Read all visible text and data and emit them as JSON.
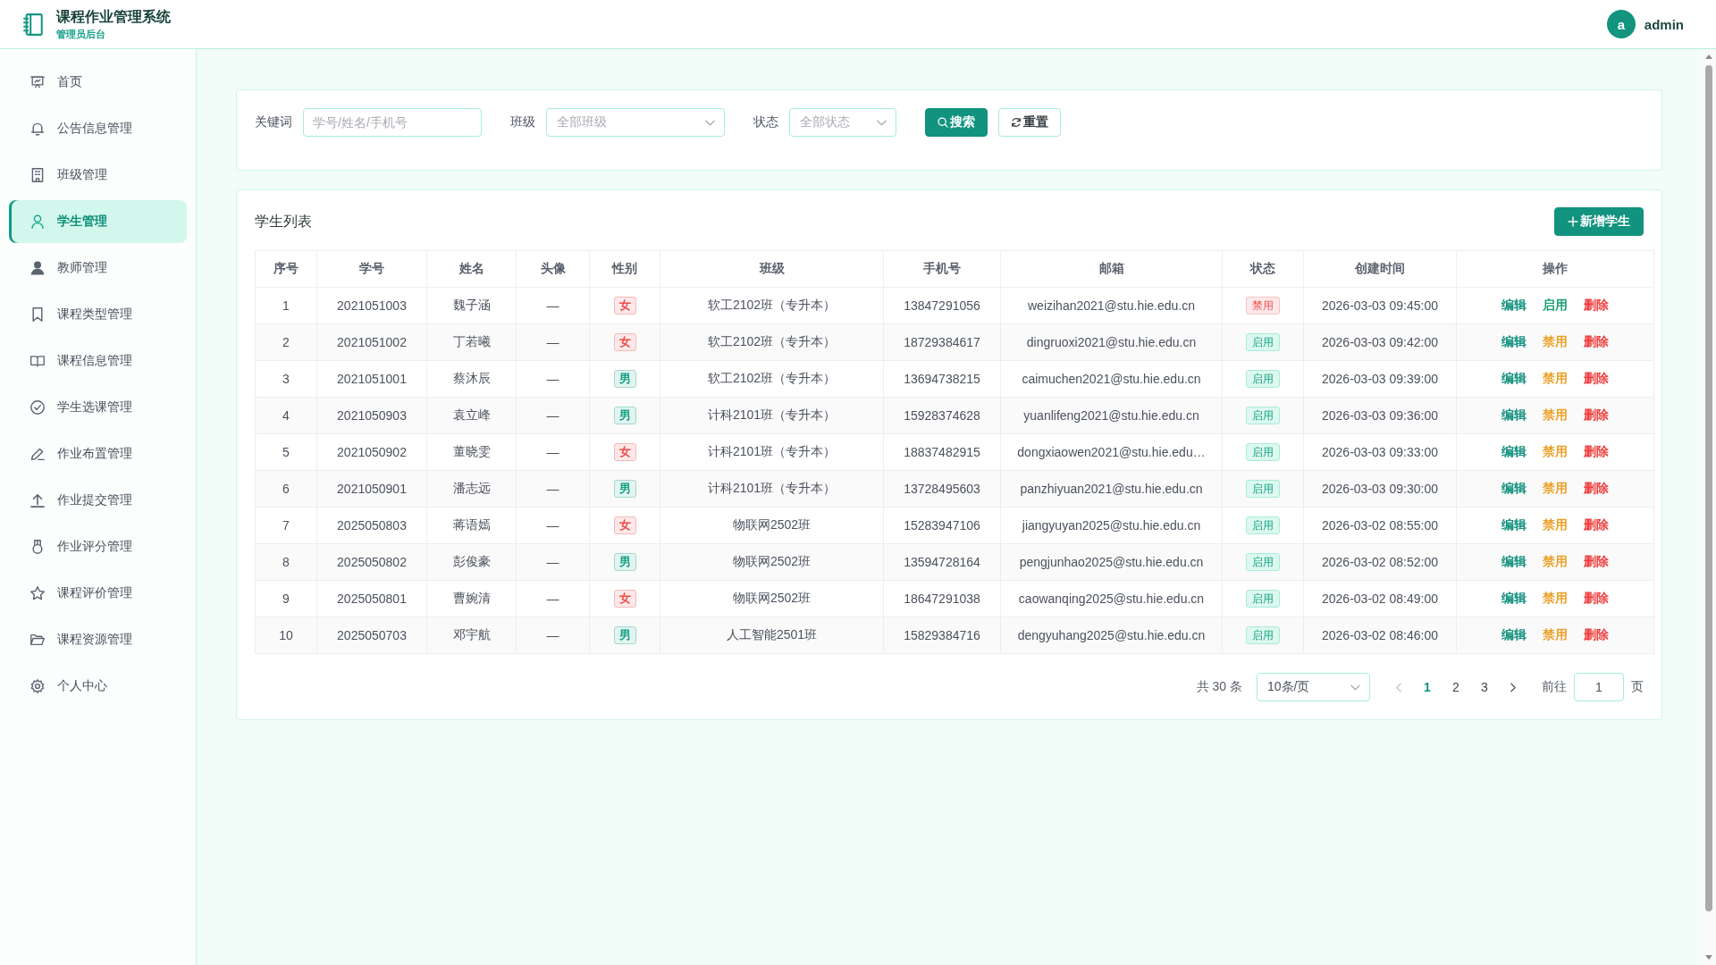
{
  "header": {
    "title": "课程作业管理系统",
    "subtitle": "管理员后台",
    "user": {
      "initial": "a",
      "name": "admin"
    }
  },
  "sidebar": {
    "items": [
      {
        "label": "首页",
        "selected": false
      },
      {
        "label": "公告信息管理",
        "selected": false
      },
      {
        "label": "班级管理",
        "selected": false
      },
      {
        "label": "学生管理",
        "selected": true
      },
      {
        "label": "教师管理",
        "selected": false
      },
      {
        "label": "课程类型管理",
        "selected": false
      },
      {
        "label": "课程信息管理",
        "selected": false
      },
      {
        "label": "学生选课管理",
        "selected": false
      },
      {
        "label": "作业布置管理",
        "selected": false
      },
      {
        "label": "作业提交管理",
        "selected": false
      },
      {
        "label": "作业评分管理",
        "selected": false
      },
      {
        "label": "课程评价管理",
        "selected": false
      },
      {
        "label": "课程资源管理",
        "selected": false
      },
      {
        "label": "个人中心",
        "selected": false
      }
    ]
  },
  "filters": {
    "fields": [
      {
        "label": "关键词",
        "kind": "input",
        "placeholder": "学号/姓名/手机号"
      },
      {
        "label": "班级",
        "kind": "select",
        "placeholder": "全部班级"
      },
      {
        "label": "状态",
        "kind": "select",
        "placeholder": "全部状态"
      }
    ],
    "buttons": [
      {
        "label": "搜索",
        "kind": "search"
      },
      {
        "label": "重置",
        "kind": "reset"
      }
    ]
  },
  "student_list": {
    "title": "学生列表",
    "add_button": "新增学生",
    "columns": [
      "序号",
      "学号",
      "姓名",
      "头像",
      "性别",
      "班级",
      "手机号",
      "邮箱",
      "状态",
      "创建时间",
      "操作"
    ],
    "rows": [
      {
        "index": "1",
        "student_id": "2021051003",
        "name": "魏子涵",
        "avatar": "—",
        "gender": {
          "label": "女",
          "color": "#f04b4b"
        },
        "class": "软工2102班（专升本）",
        "phone": "13847291056",
        "email": "weizihan2021@stu.hie.edu.cn",
        "status": {
          "label": "禁用",
          "enabled": false
        },
        "created_at": "2026-03-03 09:45:00",
        "actions": [
          {
            "label": "编辑",
            "kind": "edit"
          },
          {
            "label": "启用",
            "kind": "enable"
          },
          {
            "label": "删除",
            "kind": "delete"
          }
        ]
      },
      {
        "index": "2",
        "student_id": "2021051002",
        "name": "丁若曦",
        "avatar": "—",
        "gender": {
          "label": "女",
          "color": "#f04b4b"
        },
        "class": "软工2102班（专升本）",
        "phone": "18729384617",
        "email": "dingruoxi2021@stu.hie.edu.cn",
        "status": {
          "label": "启用",
          "enabled": true
        },
        "created_at": "2026-03-03 09:42:00",
        "actions": [
          {
            "label": "编辑",
            "kind": "edit"
          },
          {
            "label": "禁用",
            "kind": "disable"
          },
          {
            "label": "删除",
            "kind": "delete"
          }
        ]
      },
      {
        "index": "3",
        "student_id": "2021051001",
        "name": "蔡沐辰",
        "avatar": "—",
        "gender": {
          "label": "男",
          "color": "#13a084"
        },
        "class": "软工2102班（专升本）",
        "phone": "13694738215",
        "email": "caimuchen2021@stu.hie.edu.cn",
        "status": {
          "label": "启用",
          "enabled": true
        },
        "created_at": "2026-03-03 09:39:00",
        "actions": [
          {
            "label": "编辑",
            "kind": "edit"
          },
          {
            "label": "禁用",
            "kind": "disable"
          },
          {
            "label": "删除",
            "kind": "delete"
          }
        ]
      },
      {
        "index": "4",
        "student_id": "2021050903",
        "name": "袁立峰",
        "avatar": "—",
        "gender": {
          "label": "男",
          "color": "#13a084"
        },
        "class": "计科2101班（专升本）",
        "phone": "15928374628",
        "email": "yuanlifeng2021@stu.hie.edu.cn",
        "status": {
          "label": "启用",
          "enabled": true
        },
        "created_at": "2026-03-03 09:36:00",
        "actions": [
          {
            "label": "编辑",
            "kind": "edit"
          },
          {
            "label": "禁用",
            "kind": "disable"
          },
          {
            "label": "删除",
            "kind": "delete"
          }
        ]
      },
      {
        "index": "5",
        "student_id": "2021050902",
        "name": "董晓雯",
        "avatar": "—",
        "gender": {
          "label": "女",
          "color": "#f04b4b"
        },
        "class": "计科2101班（专升本）",
        "phone": "18837482915",
        "email": "dongxiaowen2021@stu.hie.edu…",
        "status": {
          "label": "启用",
          "enabled": true
        },
        "created_at": "2026-03-03 09:33:00",
        "actions": [
          {
            "label": "编辑",
            "kind": "edit"
          },
          {
            "label": "禁用",
            "kind": "disable"
          },
          {
            "label": "删除",
            "kind": "delete"
          }
        ]
      },
      {
        "index": "6",
        "student_id": "2021050901",
        "name": "潘志远",
        "avatar": "—",
        "gender": {
          "label": "男",
          "color": "#13a084"
        },
        "class": "计科2101班（专升本）",
        "phone": "13728495603",
        "email": "panzhiyuan2021@stu.hie.edu.cn",
        "status": {
          "label": "启用",
          "enabled": true
        },
        "created_at": "2026-03-03 09:30:00",
        "actions": [
          {
            "label": "编辑",
            "kind": "edit"
          },
          {
            "label": "禁用",
            "kind": "disable"
          },
          {
            "label": "删除",
            "kind": "delete"
          }
        ]
      },
      {
        "index": "7",
        "student_id": "2025050803",
        "name": "蒋语嫣",
        "avatar": "—",
        "gender": {
          "label": "女",
          "color": "#f04b4b"
        },
        "class": "物联网2502班",
        "phone": "15283947106",
        "email": "jiangyuyan2025@stu.hie.edu.cn",
        "status": {
          "label": "启用",
          "enabled": true
        },
        "created_at": "2026-03-02 08:55:00",
        "actions": [
          {
            "label": "编辑",
            "kind": "edit"
          },
          {
            "label": "禁用",
            "kind": "disable"
          },
          {
            "label": "删除",
            "kind": "delete"
          }
        ]
      },
      {
        "index": "8",
        "student_id": "2025050802",
        "name": "彭俊豪",
        "avatar": "—",
        "gender": {
          "label": "男",
          "color": "#13a084"
        },
        "class": "物联网2502班",
        "phone": "13594728164",
        "email": "pengjunhao2025@stu.hie.edu.cn",
        "status": {
          "label": "启用",
          "enabled": true
        },
        "created_at": "2026-03-02 08:52:00",
        "actions": [
          {
            "label": "编辑",
            "kind": "edit"
          },
          {
            "label": "禁用",
            "kind": "disable"
          },
          {
            "label": "删除",
            "kind": "delete"
          }
        ]
      },
      {
        "index": "9",
        "student_id": "2025050801",
        "name": "曹婉清",
        "avatar": "—",
        "gender": {
          "label": "女",
          "color": "#f04b4b"
        },
        "class": "物联网2502班",
        "phone": "18647291038",
        "email": "caowanqing2025@stu.hie.edu.cn",
        "status": {
          "label": "启用",
          "enabled": true
        },
        "created_at": "2026-03-02 08:49:00",
        "actions": [
          {
            "label": "编辑",
            "kind": "edit"
          },
          {
            "label": "禁用",
            "kind": "disable"
          },
          {
            "label": "删除",
            "kind": "delete"
          }
        ]
      },
      {
        "index": "10",
        "student_id": "2025050703",
        "name": "邓宇航",
        "avatar": "—",
        "gender": {
          "label": "男",
          "color": "#13a084"
        },
        "class": "人工智能2501班",
        "phone": "15829384716",
        "email": "dengyuhang2025@stu.hie.edu.cn",
        "status": {
          "label": "启用",
          "enabled": true
        },
        "created_at": "2026-03-02 08:46:00",
        "actions": [
          {
            "label": "编辑",
            "kind": "edit"
          },
          {
            "label": "禁用",
            "kind": "disable"
          },
          {
            "label": "删除",
            "kind": "delete"
          }
        ]
      }
    ]
  },
  "pagination": {
    "total": "共 30 条",
    "page_size": "10条/页",
    "prev": {
      "disabled": true
    },
    "pages": [
      {
        "label": "1",
        "selected": true
      },
      {
        "label": "2",
        "selected": false
      },
      {
        "label": "3",
        "selected": false
      }
    ],
    "next": {
      "disabled": false
    },
    "jump_label": "前往",
    "jump_value": "1",
    "jump_suffix": "页"
  }
}
